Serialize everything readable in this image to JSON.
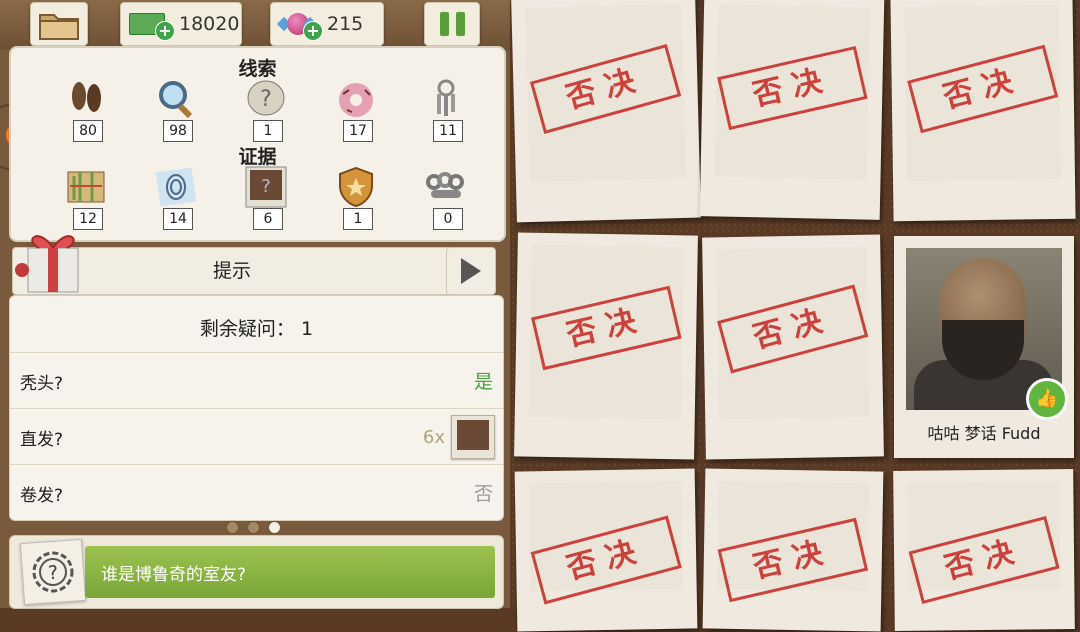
{
  "topbar": {
    "money": "18020",
    "candy": "215"
  },
  "clues": {
    "title": "线索",
    "items": [
      {
        "name": "footprints",
        "count": "80"
      },
      {
        "name": "magnifier",
        "count": "98"
      },
      {
        "name": "unknown-clue",
        "count": "1"
      },
      {
        "name": "donut",
        "count": "17"
      },
      {
        "name": "keys",
        "count": "11"
      }
    ]
  },
  "evidence": {
    "title": "证据",
    "items": [
      {
        "name": "map",
        "count": "12"
      },
      {
        "name": "fingerprint",
        "count": "14"
      },
      {
        "name": "unknown-photo",
        "count": "6"
      },
      {
        "name": "badge",
        "count": "1"
      },
      {
        "name": "brass-knuckles",
        "count": "0"
      }
    ]
  },
  "hint": {
    "label": "提示"
  },
  "questions": {
    "remaining": "剩余疑问： 1",
    "rows": [
      {
        "label": "秃头?",
        "answer": "是"
      },
      {
        "label": "直发?",
        "multiplier": "6x"
      },
      {
        "label": "卷发?",
        "answer": "否"
      }
    ]
  },
  "quest": {
    "text": "谁是博鲁奇的室友?"
  },
  "board": {
    "stamp_text": "否决",
    "suspect_name": "咕咕 梦话 Fudd"
  },
  "colors": {
    "stamp": "#c9302c",
    "yes": "#4aa040",
    "quest_bar": "#8cb444"
  }
}
